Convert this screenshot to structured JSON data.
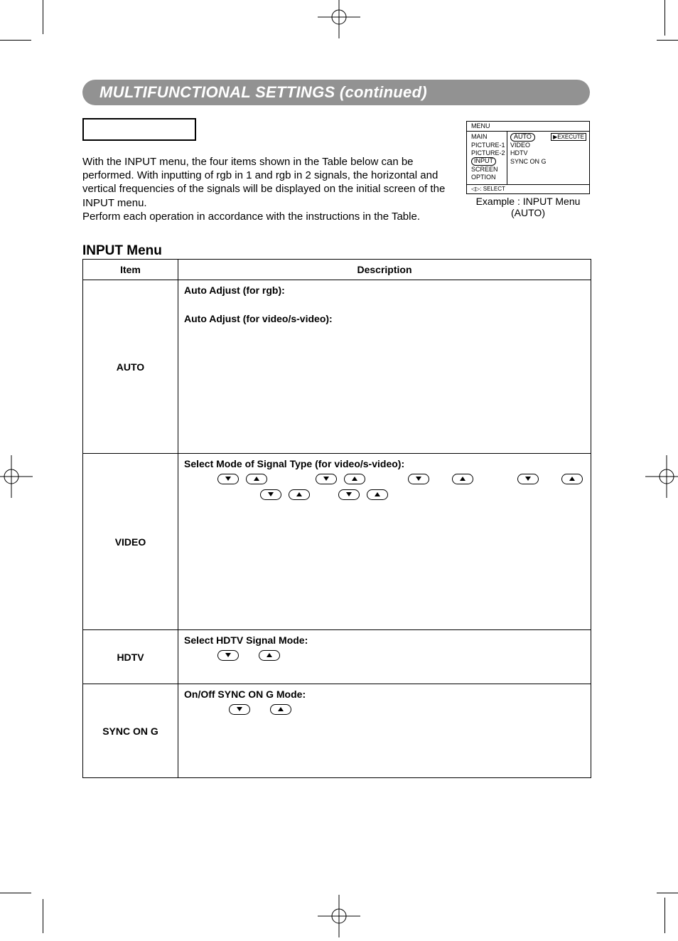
{
  "header_title": "MULTIFUNCTIONAL SETTINGS (continued)",
  "intro_text": "With the INPUT menu, the four items shown in the Table below can be performed. With inputting of rgb in 1 and rgb in 2 signals, the horizontal and vertical frequencies of the signals will be displayed on the initial screen of the INPUT menu.\nPerform each operation in accordance with the instructions in the Table.",
  "osd": {
    "title": "MENU",
    "left_items": [
      "MAIN",
      "PICTURE-1",
      "PICTURE-2",
      "INPUT",
      "SCREEN",
      "OPTION"
    ],
    "left_selected_index": 3,
    "right_items": [
      "AUTO",
      "VIDEO",
      "HDTV",
      "SYNC ON G"
    ],
    "right_selected_index": 0,
    "exec_label": "▶EXECUTE",
    "footer": ": SELECT",
    "caption_line1": "Example : INPUT Menu",
    "caption_line2": "(AUTO)"
  },
  "table_title": "INPUT Menu",
  "columns": {
    "item": "Item",
    "description": "Description"
  },
  "rows": {
    "auto": {
      "item": "AUTO",
      "line1": "Auto Adjust (for rgb):",
      "line2": "Auto Adjust (for video/s-video):"
    },
    "video": {
      "item": "VIDEO",
      "line1": "Select Mode of Signal Type (for video/s-video):"
    },
    "hdtv": {
      "item": "HDTV",
      "line1": "Select HDTV Signal Mode:"
    },
    "sync": {
      "item": "SYNC ON G",
      "line1": "On/Off SYNC ON G Mode:"
    }
  }
}
